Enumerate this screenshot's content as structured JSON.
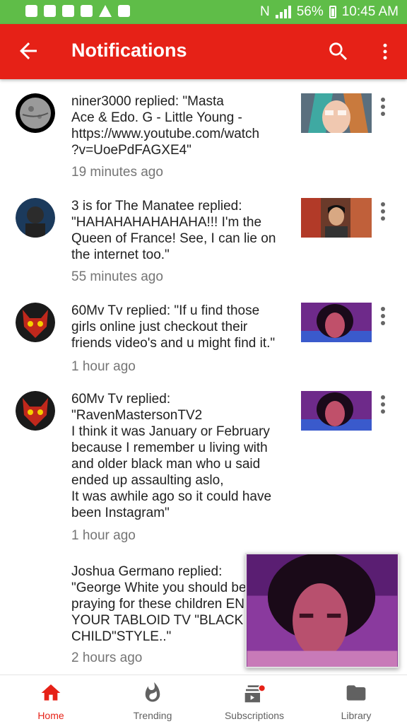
{
  "status_bar": {
    "battery": "56%",
    "time": "10:45 AM"
  },
  "app_bar": {
    "title": "Notifications"
  },
  "notifications": [
    {
      "message": "niner3000 replied: \"Masta\nAce & Edo. G - Little Young -\nhttps://www.youtube.com/watch\n?v=UoePdFAGXE4\"",
      "time": "19 minutes ago",
      "avatar": "moon"
    },
    {
      "message": "3 is for The Manatee replied:\n\"HAHAHAHAHAHAHA!!! I'm the\nQueen of France! See, I can lie on\nthe internet too.\"",
      "time": "55 minutes ago",
      "avatar": "man-blue"
    },
    {
      "message": "60Mv Tv replied: \"If u find those\ngirls online just checkout their\nfriends video's and u might find it.\"",
      "time": "1 hour ago",
      "avatar": "demon-mask"
    },
    {
      "message": "60Mv Tv replied:\n\"RavenMastersonTV2\nI think it was January or February\nbecause I remember u living with\nand older black man who u said\nended up assaulting aslo,\nIt was awhile ago so it could have\nbeen Instagram\"",
      "time": "1 hour ago",
      "avatar": "demon-mask"
    },
    {
      "message": "Joshua Germano replied:\n\"George White you should be\npraying for these children EN\nYOUR TABLOID TV \"BLACK\nCHILD\"STYLE..\"",
      "time": "2 hours ago",
      "avatar": ""
    }
  ],
  "bottom_nav": [
    {
      "label": "Home",
      "icon": "home-icon",
      "active": true
    },
    {
      "label": "Trending",
      "icon": "flame-icon",
      "active": false
    },
    {
      "label": "Subscriptions",
      "icon": "subscriptions-icon",
      "active": false
    },
    {
      "label": "Library",
      "icon": "folder-icon",
      "active": false
    }
  ],
  "colors": {
    "accent": "#e62117",
    "status_bar": "#5fbd48",
    "text": "#212121",
    "secondary_text": "#757575"
  }
}
